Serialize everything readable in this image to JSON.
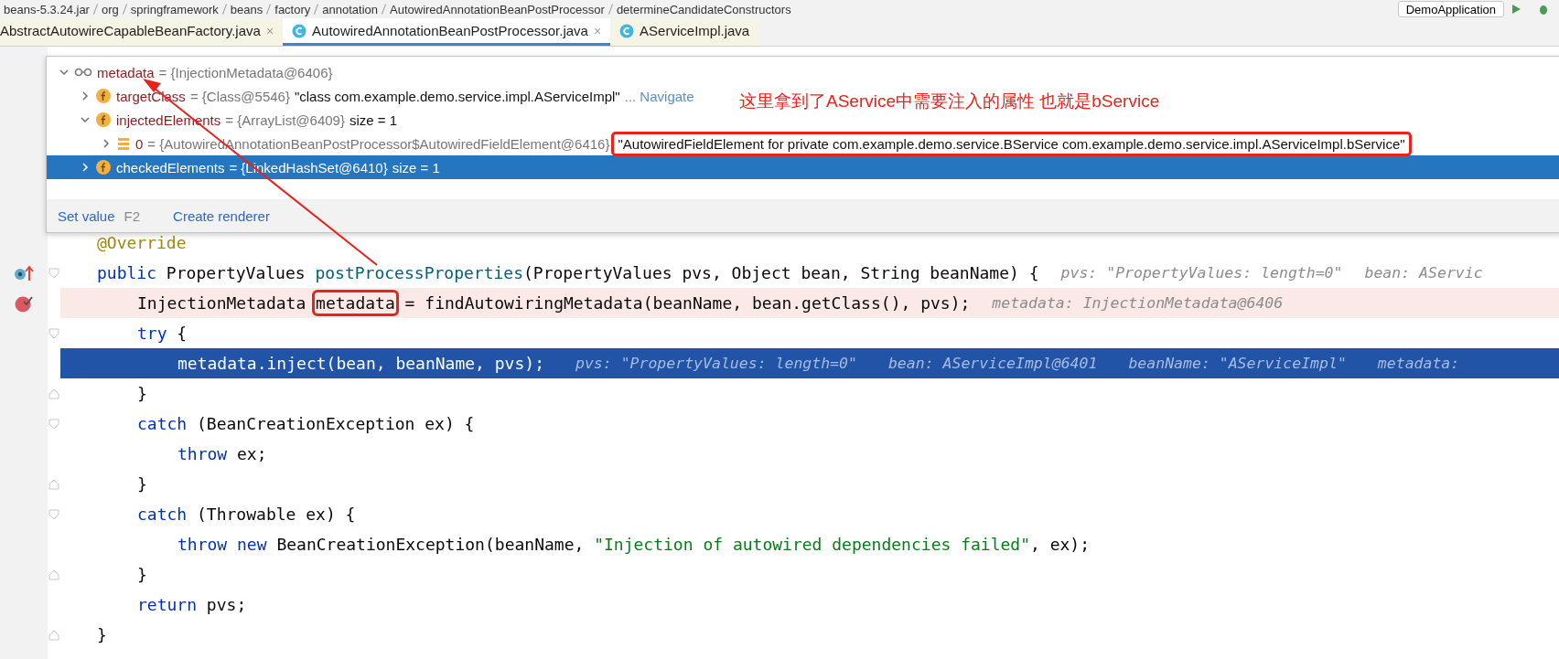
{
  "breadcrumbs": [
    "beans-5.3.24.jar",
    "org",
    "springframework",
    "beans",
    "factory",
    "annotation",
    "AutowiredAnnotationBeanPostProcessor",
    "determineCandidateConstructors"
  ],
  "run_config": "DemoApplication",
  "tabs": [
    {
      "label": "AbstractAutowireCapableBeanFactory.java",
      "selected": false,
      "close": "×"
    },
    {
      "label": "AutowiredAnnotationBeanPostProcessor.java",
      "selected": true,
      "close": "×"
    },
    {
      "label": "AServiceImpl.java",
      "selected": false
    }
  ],
  "popup": {
    "tree": [
      {
        "kind": "watch",
        "name": "metadata",
        "value": "= {InjectionMetadata@6406}",
        "expanded": true,
        "selected": false,
        "children": [
          {
            "kind": "field",
            "name": "targetClass",
            "value": "= {Class@5546}",
            "string": "\"class com.example.demo.service.impl.AServiceImpl\"",
            "link": "... Navigate",
            "expanded": false,
            "selected": false
          },
          {
            "kind": "field",
            "name": "injectedElements",
            "value": "= {ArrayList@6409}",
            "string": "size = 1",
            "expanded": true,
            "selected": false,
            "children": [
              {
                "kind": "element",
                "name": "0",
                "value": "= {AutowiredAnnotationBeanPostProcessor$AutowiredFieldElement@6416}",
                "string": "\"AutowiredFieldElement for private com.example.demo.service.BService com.example.demo.service.impl.AServiceImpl.bService\"",
                "boxed": true,
                "expanded": false,
                "selected": false
              }
            ]
          },
          {
            "kind": "field",
            "name": "checkedElements",
            "value": "= {LinkedHashSet@6410}",
            "string": "size = 1",
            "expanded": false,
            "selected": true
          }
        ]
      }
    ],
    "footer": [
      {
        "label": "Set value",
        "shortcut": "F2"
      },
      {
        "label": "Create renderer"
      }
    ]
  },
  "note": "这里拿到了AService中需要注入的属性 也就是bService",
  "code": [
    {
      "kind": "normal",
      "tokens": [
        {
          "kind": "annotation",
          "s": "@Override"
        }
      ]
    },
    {
      "kind": "normal",
      "method_breakpoint": true,
      "tokens": [
        {
          "kind": "keyword",
          "s": "public"
        },
        {
          "kind": "plain",
          "s": " PropertyValues "
        },
        {
          "kind": "method",
          "s": "postProcessProperties"
        },
        {
          "kind": "plain",
          "s": "(PropertyValues pvs, Object bean, String beanName) {"
        }
      ],
      "hints": [
        "pvs: \"PropertyValues: length=0\"",
        "bean: AServic"
      ],
      "closing": "}",
      "children": [
        {
          "kind": "breakpoint",
          "tokens": [
            {
              "kind": "plain",
              "s": "InjectionMetadata "
            },
            {
              "kind": "plain",
              "s": "metadata",
              "boxed": true
            },
            {
              "kind": "plain",
              "s": " = findAutowiringMetadata(beanName, bean.getClass(), pvs);"
            }
          ],
          "hints": [
            "metadata: InjectionMetadata@6406"
          ]
        },
        {
          "kind": "normal",
          "tokens": [
            {
              "kind": "keyword",
              "s": "try"
            },
            {
              "kind": "plain",
              "s": " {"
            }
          ],
          "closing": "}",
          "children": [
            {
              "kind": "execution",
              "tokens": [
                {
                  "kind": "plain",
                  "s": "metadata.inject(bean, beanName, pvs);"
                }
              ],
              "hints": [
                "pvs: \"PropertyValues: length=0\"",
                "bean: AServiceImpl@6401",
                "beanName: \"AServiceImpl\"",
                "metadata:"
              ]
            }
          ]
        },
        {
          "kind": "normal",
          "tokens": [
            {
              "kind": "keyword",
              "s": "catch"
            },
            {
              "kind": "plain",
              "s": " (BeanCreationException ex) {"
            }
          ],
          "closing": "}",
          "children": [
            {
              "kind": "normal",
              "tokens": [
                {
                  "kind": "keyword",
                  "s": "throw"
                },
                {
                  "kind": "plain",
                  "s": " ex;"
                }
              ]
            }
          ]
        },
        {
          "kind": "normal",
          "tokens": [
            {
              "kind": "keyword",
              "s": "catch"
            },
            {
              "kind": "plain",
              "s": " (Throwable ex) {"
            }
          ],
          "closing": "}",
          "children": [
            {
              "kind": "normal",
              "tokens": [
                {
                  "kind": "keyword",
                  "s": "throw new"
                },
                {
                  "kind": "plain",
                  "s": " BeanCreationException(beanName, "
                },
                {
                  "kind": "string",
                  "s": "\"Injection of autowired dependencies failed\""
                },
                {
                  "kind": "plain",
                  "s": ", ex);"
                }
              ]
            }
          ]
        },
        {
          "kind": "normal",
          "tokens": [
            {
              "kind": "keyword",
              "s": "return"
            },
            {
              "kind": "plain",
              "s": " pvs;"
            }
          ]
        }
      ]
    }
  ]
}
